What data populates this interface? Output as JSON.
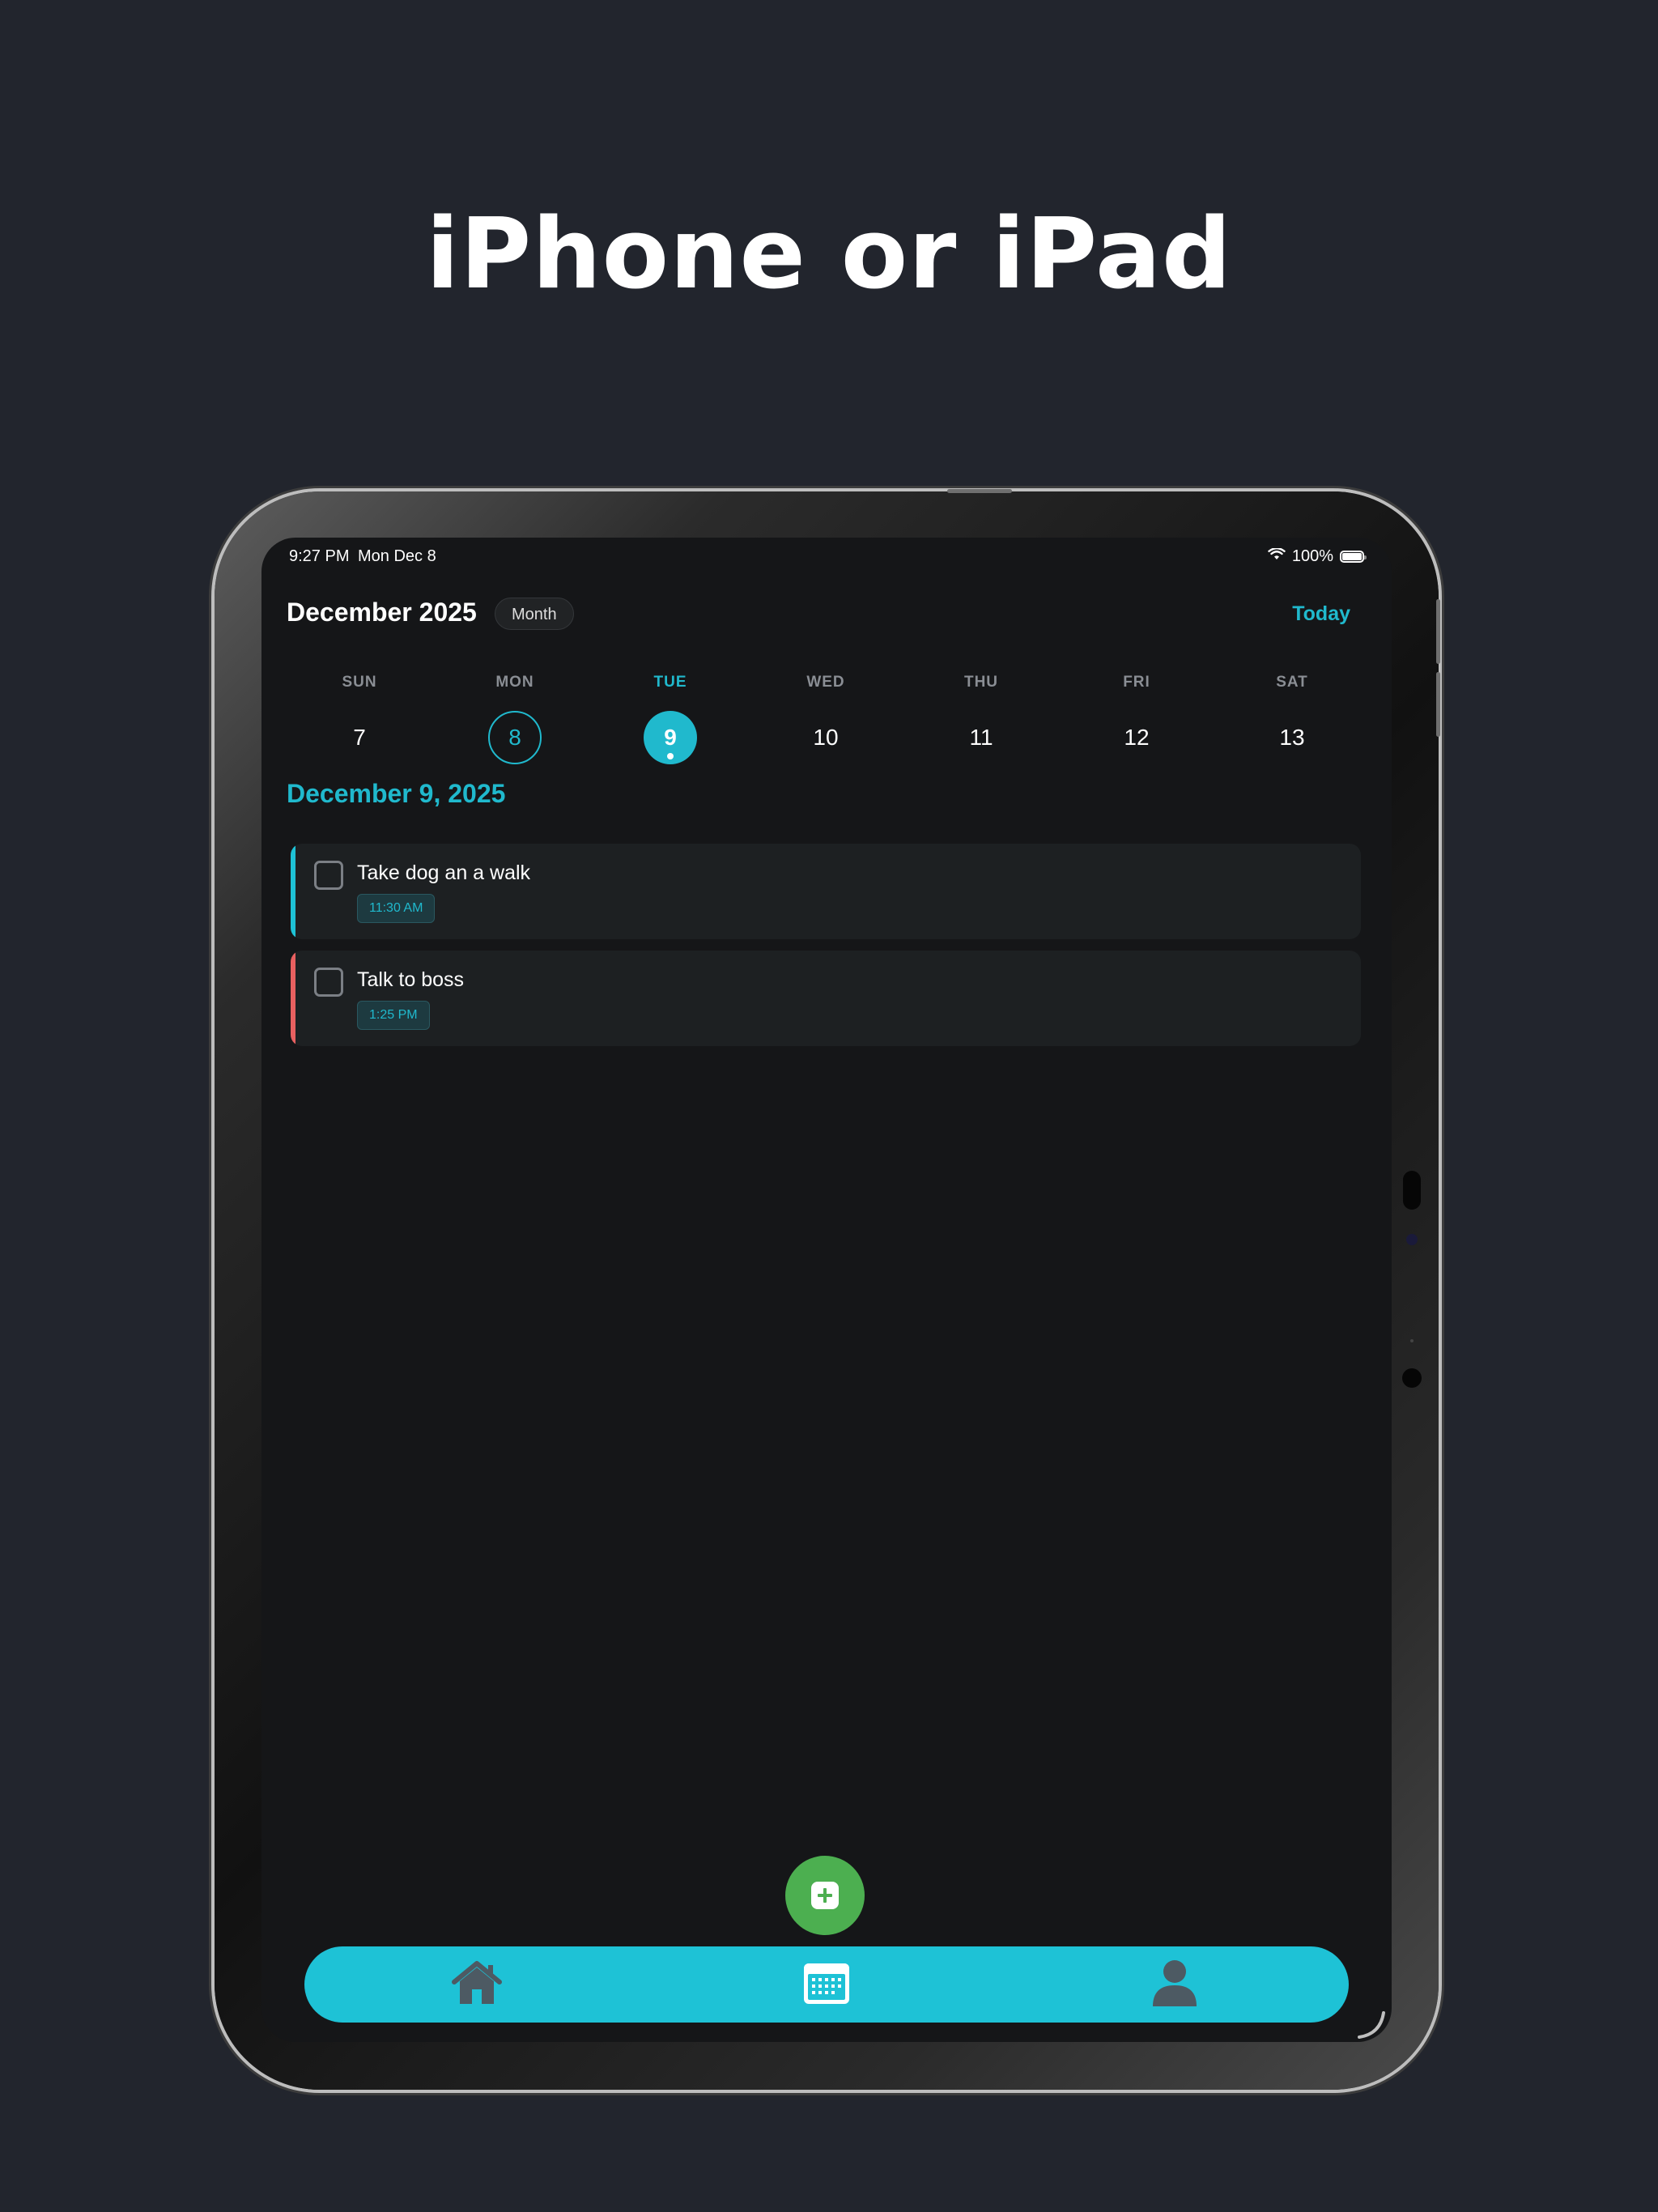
{
  "headline": "iPhone or iPad",
  "status_bar": {
    "time": "9:27 PM",
    "date": "Mon Dec 8",
    "battery": "100%"
  },
  "header": {
    "month_title": "December 2025",
    "view_mode": "Month",
    "today_label": "Today"
  },
  "week": [
    {
      "name": "SUN",
      "number": "7"
    },
    {
      "name": "MON",
      "number": "8"
    },
    {
      "name": "TUE",
      "number": "9"
    },
    {
      "name": "WED",
      "number": "10"
    },
    {
      "name": "THU",
      "number": "11"
    },
    {
      "name": "FRI",
      "number": "12"
    },
    {
      "name": "SAT",
      "number": "13"
    }
  ],
  "selected_date_heading": "December 9, 2025",
  "tasks": [
    {
      "title": "Take dog an a walk",
      "time": "11:30 AM",
      "color": "#1ec2d6"
    },
    {
      "title": "Talk to boss",
      "time": "1:25 PM",
      "color": "#e86060"
    }
  ],
  "colors": {
    "accent": "#20b9cd",
    "fab": "#4caf50",
    "tabbar": "#1ec2d6",
    "background": "#22252d"
  },
  "tabbar": {
    "items": [
      {
        "icon": "home-icon"
      },
      {
        "icon": "calendar-icon"
      },
      {
        "icon": "profile-icon"
      }
    ]
  }
}
